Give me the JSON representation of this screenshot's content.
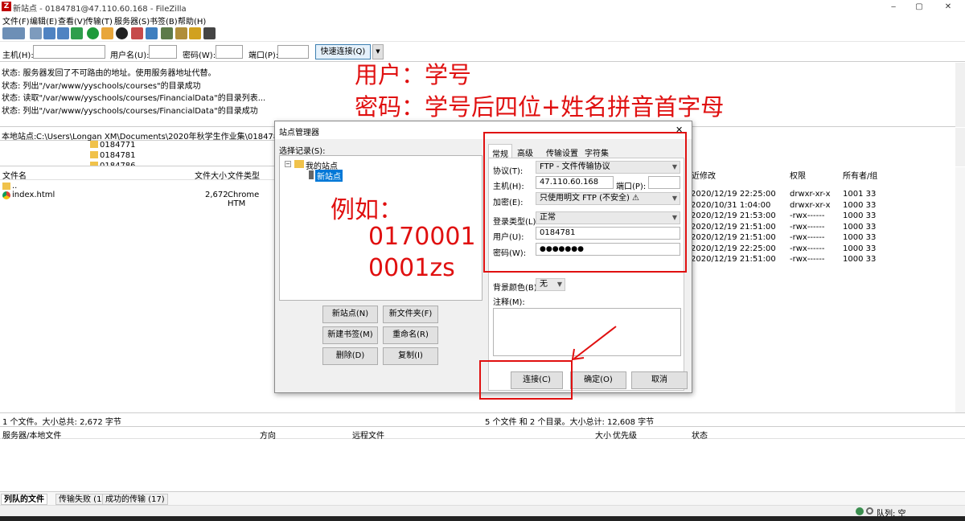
{
  "window": {
    "title": "新站点 - 0184781@47.110.60.168 - FileZilla",
    "minimize": "‒",
    "maximize": "▢",
    "close": "✕"
  },
  "menu": [
    "文件(F)",
    "编辑(E)",
    "查看(V)",
    "传输(T)",
    "服务器(S)",
    "书签(B)",
    "帮助(H)"
  ],
  "quickconnect": {
    "host_label": "主机(H):",
    "user_label": "用户名(U):",
    "pass_label": "密码(W):",
    "port_label": "端口(P):",
    "connect_label": "快速连接(Q)",
    "dropdown": "▼"
  },
  "log": [
    "状态: 服务器发回了不可路由的地址。使用服务器地址代替。",
    "状态: 列出\"/var/www/yyschools/courses\"的目录成功",
    "状态: 读取\"/var/www/yyschools/courses/FinancialData\"的目录列表...",
    "状态: 列出\"/var/www/yyschools/courses/FinancialData\"的目录成功"
  ],
  "annotations": {
    "line1": "用户：学号",
    "line2": "密码：学号后四位+姓名拼音首字母",
    "example_title": "例如：",
    "example_1": "0170001",
    "example_2": "0001zs"
  },
  "local": {
    "site_label": "本地站点:",
    "path": "C:\\Users\\Longan XM\\Documents\\2020年秋学生作业集\\0184781\\",
    "tree": [
      "0184771",
      "0184781",
      "0184786"
    ],
    "columns": {
      "name": "文件名",
      "size": "文件大小",
      "type": "文件类型"
    },
    "files": [
      {
        "name": "..",
        "size": "",
        "type": ""
      },
      {
        "name": "index.html",
        "size": "2,672",
        "type": "Chrome HTM"
      }
    ],
    "status": "1 个文件。大小总共: 2,672 字节"
  },
  "remote": {
    "columns": {
      "modified": "近修改",
      "perms": "权限",
      "owner": "所有者/组"
    },
    "rows": [
      {
        "modified": "2020/12/19 22:25:00",
        "perms": "drwxr-xr-x",
        "owner": "1001 33"
      },
      {
        "modified": "2020/10/31 1:04:00",
        "perms": "drwxr-xr-x",
        "owner": "1000 33"
      },
      {
        "modified": "2020/12/19 21:53:00",
        "perms": "-rwx------",
        "owner": "1000 33"
      },
      {
        "modified": "2020/12/19 21:51:00",
        "perms": "-rwx------",
        "owner": "1000 33"
      },
      {
        "modified": "2020/12/19 21:51:00",
        "perms": "-rwx------",
        "owner": "1000 33"
      },
      {
        "modified": "2020/12/19 22:25:00",
        "perms": "-rwx------",
        "owner": "1000 33"
      },
      {
        "modified": "2020/12/19 21:51:00",
        "perms": "-rwx------",
        "owner": "1000 33"
      }
    ],
    "status": "5 个文件 和 2 个目录。大小总计: 12,608 字节"
  },
  "queue": {
    "columns": {
      "server": "服务器/本地文件",
      "direction": "方向",
      "remote": "远程文件",
      "size": "大小",
      "priority": "优先级",
      "state": "状态"
    },
    "tabs": [
      "列队的文件",
      "传输失败 (1)",
      "成功的传输 (17)"
    ],
    "queue_status": "队列: 空"
  },
  "site_manager": {
    "title": "站点管理器",
    "close": "✕",
    "select_label": "选择记录(S):",
    "tree_root": "我的站点",
    "tree_site": "新站点",
    "buttons": {
      "new_site": "新站点(N)",
      "new_folder": "新文件夹(F)",
      "new_bookmark": "新建书签(M)",
      "rename": "重命名(R)",
      "delete": "删除(D)",
      "copy": "复制(I)",
      "connect": "连接(C)",
      "ok": "确定(O)",
      "cancel": "取消"
    },
    "tabs": [
      "常规",
      "高级",
      "传输设置",
      "字符集"
    ],
    "labels": {
      "protocol": "协议(T):",
      "host": "主机(H):",
      "port": "端口(P):",
      "encryption": "加密(E):",
      "logon": "登录类型(L):",
      "user": "用户(U):",
      "password": "密码(W):",
      "bgcolor": "背景颜色(B)",
      "comments": "注释(M):"
    },
    "values": {
      "protocol": "FTP - 文件传输协议",
      "host": "47.110.60.168",
      "port": "",
      "encryption": "只使用明文 FTP (不安全) ⚠",
      "logon": "正常",
      "user": "0184781",
      "password": "●●●●●●●",
      "bgcolor": "无"
    }
  },
  "colors": {
    "annotation": "#e01010",
    "selection": "#0078d7",
    "title_icon": "#bf0000"
  }
}
